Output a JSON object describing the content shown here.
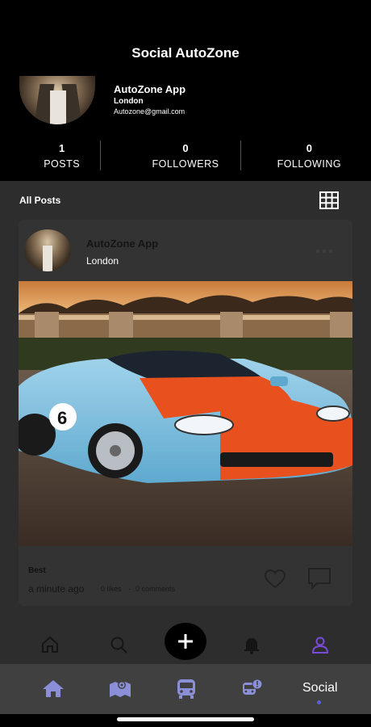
{
  "header": {
    "title": "Social AutoZone",
    "profile": {
      "name": "AutoZone App",
      "city": "London",
      "email": "Autozone@gmail.com"
    },
    "stats": [
      {
        "value": "1",
        "label": "POSTS"
      },
      {
        "value": "0",
        "label": "FOLLOWERS"
      },
      {
        "value": "0",
        "label": "FOLLOWING"
      }
    ]
  },
  "section": {
    "title": "All Posts",
    "view_icon": "grid-icon"
  },
  "post": {
    "author": "AutoZone App",
    "location": "London",
    "caption": "Best",
    "time": "a minute ago",
    "likes": "0 likes",
    "separator": "·",
    "comments": "0 comments",
    "image": "blue-orange-race-car-photo"
  },
  "inner_nav": {
    "items": [
      "home-icon",
      "search-icon",
      "add-icon",
      "bell-icon",
      "profile-icon"
    ],
    "active": "profile-icon",
    "active_color": "#7a4ad8"
  },
  "bottom_nav": {
    "items": [
      "home-icon",
      "map-icon",
      "bus-icon",
      "bus-alert-icon"
    ],
    "active_label": "Social",
    "icon_color": "#8a8fd8",
    "active_dot_color": "#5a5fe0"
  }
}
